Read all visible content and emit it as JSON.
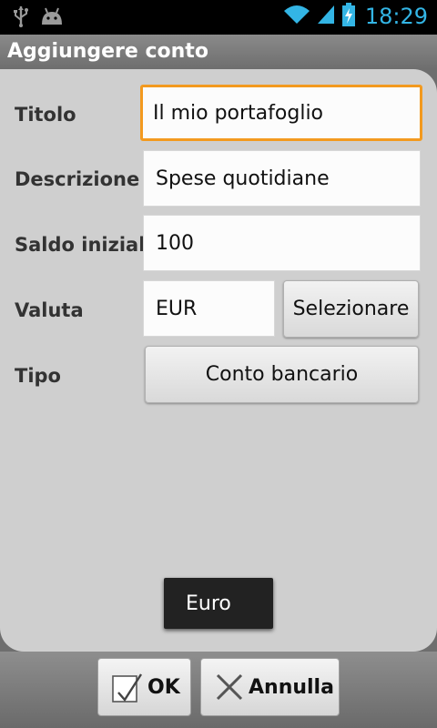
{
  "status_bar": {
    "time": "18:29",
    "time_color": "#33b5e5"
  },
  "title_bar": {
    "title": "Aggiungere conto"
  },
  "form": {
    "title_label": "Titolo",
    "title_value": "Il mio portafoglio",
    "description_label": "Descrizione",
    "description_value": "Spese quotidiane",
    "initial_balance_label": "Saldo inizial",
    "initial_balance_value": "100",
    "currency_label": "Valuta",
    "currency_value": "EUR",
    "select_button_label": "Selezionare",
    "type_label": "Tipo",
    "type_button_label": "Conto bancario"
  },
  "toast": {
    "text": "Euro"
  },
  "bottom_bar": {
    "ok_label": "OK",
    "cancel_label": "Annulla"
  },
  "colors": {
    "focus_accent": "#f39a1f",
    "panel": "#cfcfcf"
  }
}
